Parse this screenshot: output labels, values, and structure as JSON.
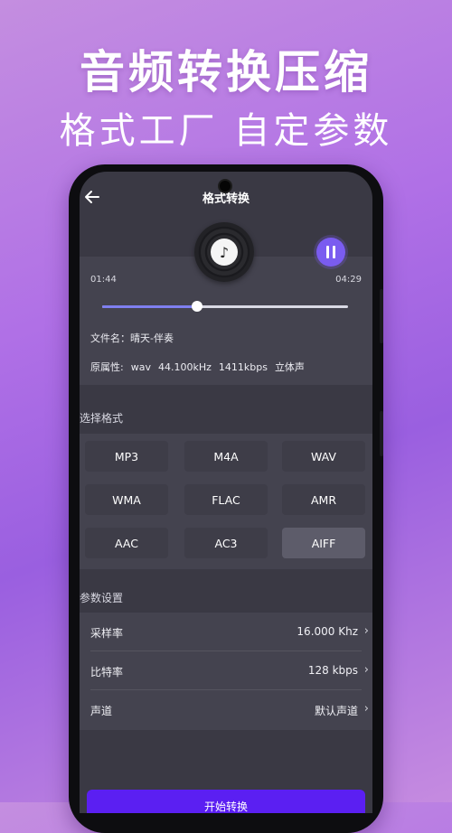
{
  "hero": {
    "title": "音频转换压缩",
    "subtitle": "格式工厂  自定参数"
  },
  "screen": {
    "title": "格式转换"
  },
  "player": {
    "current_time": "01:44",
    "total_time": "04:29",
    "progress": 0.387,
    "file_name": "文件名：晴天-伴奏",
    "attr_label": "原属性:",
    "attr_format": "wav",
    "attr_rate": "44.100kHz",
    "attr_bitrate": "1411kbps",
    "attr_channel": "立体声"
  },
  "formats": {
    "label": "选择格式",
    "items": [
      "MP3",
      "M4A",
      "WAV",
      "WMA",
      "FLAC",
      "AMR",
      "AAC",
      "AC3",
      "AIFF"
    ],
    "selected": "AIFF"
  },
  "params": {
    "label": "参数设置",
    "rows": [
      {
        "label": "采样率",
        "value": "16.000 Khz"
      },
      {
        "label": "比特率",
        "value": "128 kbps"
      },
      {
        "label": "声道",
        "value": "默认声道"
      }
    ]
  },
  "start_button": {
    "label": "开始转换"
  },
  "colors": {
    "accent": "#7a5cf0",
    "start_button": "#5b1ff2",
    "screen_bg": "#3a3944"
  },
  "icons": {
    "back": "arrow-left-icon",
    "pause": "pause-icon",
    "disc": "vinyl-disc-icon",
    "chevron": "chevron-right-icon"
  }
}
